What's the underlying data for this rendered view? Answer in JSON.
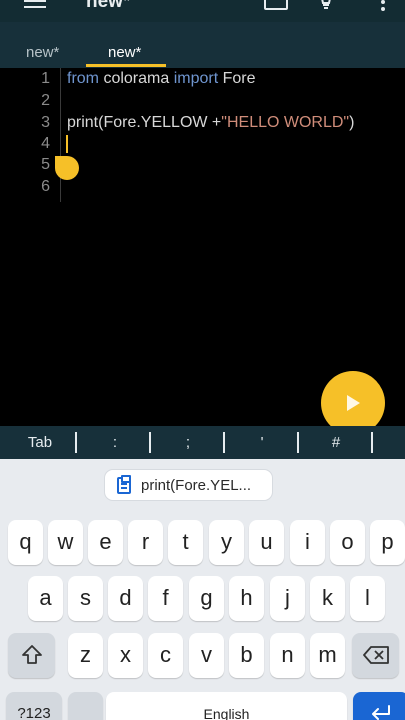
{
  "app": {
    "title": "new*"
  },
  "tabs": [
    {
      "label": "new*"
    },
    {
      "label": "new*"
    }
  ],
  "editor": {
    "line_numbers": [
      "1",
      "2",
      "3",
      "4",
      "5",
      "6"
    ],
    "line1": {
      "kw1": "from",
      "mod": " colorama ",
      "kw2": "import",
      "name": " Fore"
    },
    "line3": {
      "pre": "print(Fore.YELLOW +",
      "str": "\"HELLO WORLD\"",
      "post": ")"
    }
  },
  "symbols": [
    "Tab",
    ":",
    ";",
    "'",
    "#"
  ],
  "keyboard": {
    "clipboard": "print(Fore.YEL...",
    "row1": [
      "q",
      "w",
      "e",
      "r",
      "t",
      "y",
      "u",
      "i",
      "o",
      "p"
    ],
    "row2": [
      "a",
      "s",
      "d",
      "f",
      "g",
      "h",
      "j",
      "k",
      "l"
    ],
    "row3": [
      "z",
      "x",
      "c",
      "v",
      "b",
      "n",
      "m"
    ],
    "num_label": "?123",
    "space_label": "English"
  },
  "colors": {
    "accent": "#f6c028",
    "appbar": "#132c33",
    "tabbar": "#17303a",
    "keyboard": "#e8ebef",
    "enter": "#1a66d3"
  },
  "icons": [
    "menu-icon",
    "folder-icon",
    "bulb-icon",
    "more-icon",
    "play-icon",
    "clipboard-icon",
    "shift-icon",
    "backspace-icon",
    "globe-icon",
    "enter-icon"
  ]
}
